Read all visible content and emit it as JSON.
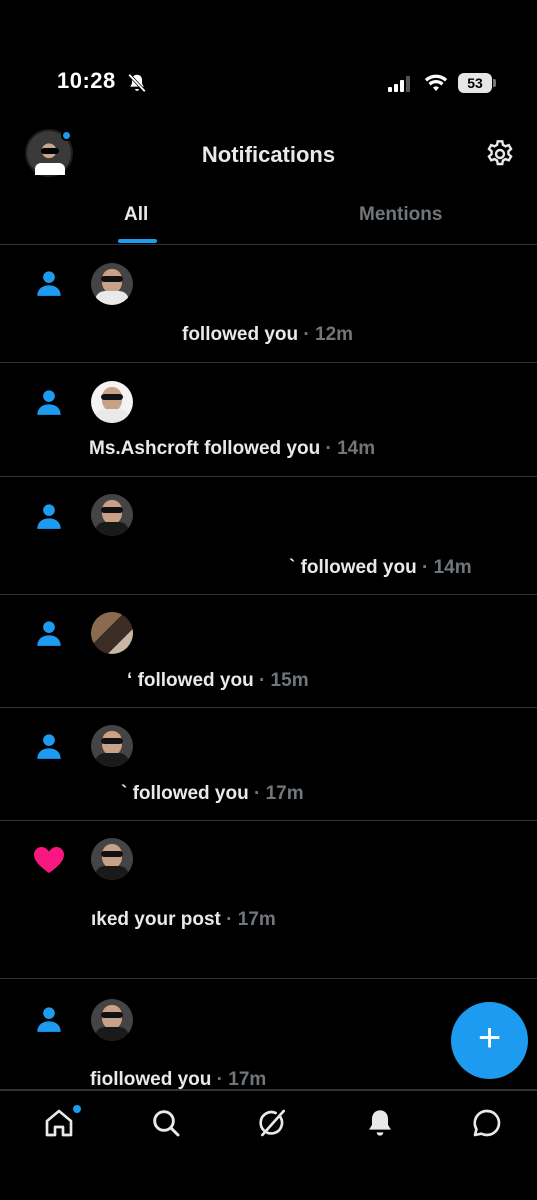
{
  "status_bar": {
    "time": "10:28",
    "battery": "53"
  },
  "header": {
    "title": "Notifications"
  },
  "tabs": [
    {
      "label": "All",
      "active": true
    },
    {
      "label": "Mentions",
      "active": false
    }
  ],
  "notifications": [
    {
      "type": "follow",
      "name": "",
      "action": "followed you",
      "time": "· 12m"
    },
    {
      "type": "follow",
      "name": "Ms.Ashcroft",
      "action": "followed you",
      "time": "· 14m"
    },
    {
      "type": "follow",
      "name": "`",
      "action": "followed you",
      "time": "· 14m"
    },
    {
      "type": "follow",
      "name": "‘",
      "action": "followed you",
      "time": "· 15m"
    },
    {
      "type": "follow",
      "name": "`",
      "action": "followed you",
      "time": "· 17m"
    },
    {
      "type": "like",
      "name": "",
      "action": "ıked your post",
      "time": "· 17m"
    },
    {
      "type": "follow",
      "name": "",
      "action": "ﬁollowed you",
      "time": "· 17m"
    }
  ],
  "fab": {
    "label": "+"
  },
  "bottom_nav": [
    {
      "icon": "home-icon"
    },
    {
      "icon": "search-icon"
    },
    {
      "icon": "grok-icon"
    },
    {
      "icon": "bell-icon"
    },
    {
      "icon": "messages-icon"
    }
  ],
  "colors": {
    "accent": "#1d9bf0",
    "like": "#f91880",
    "background": "#000000",
    "muted": "#71767b"
  }
}
